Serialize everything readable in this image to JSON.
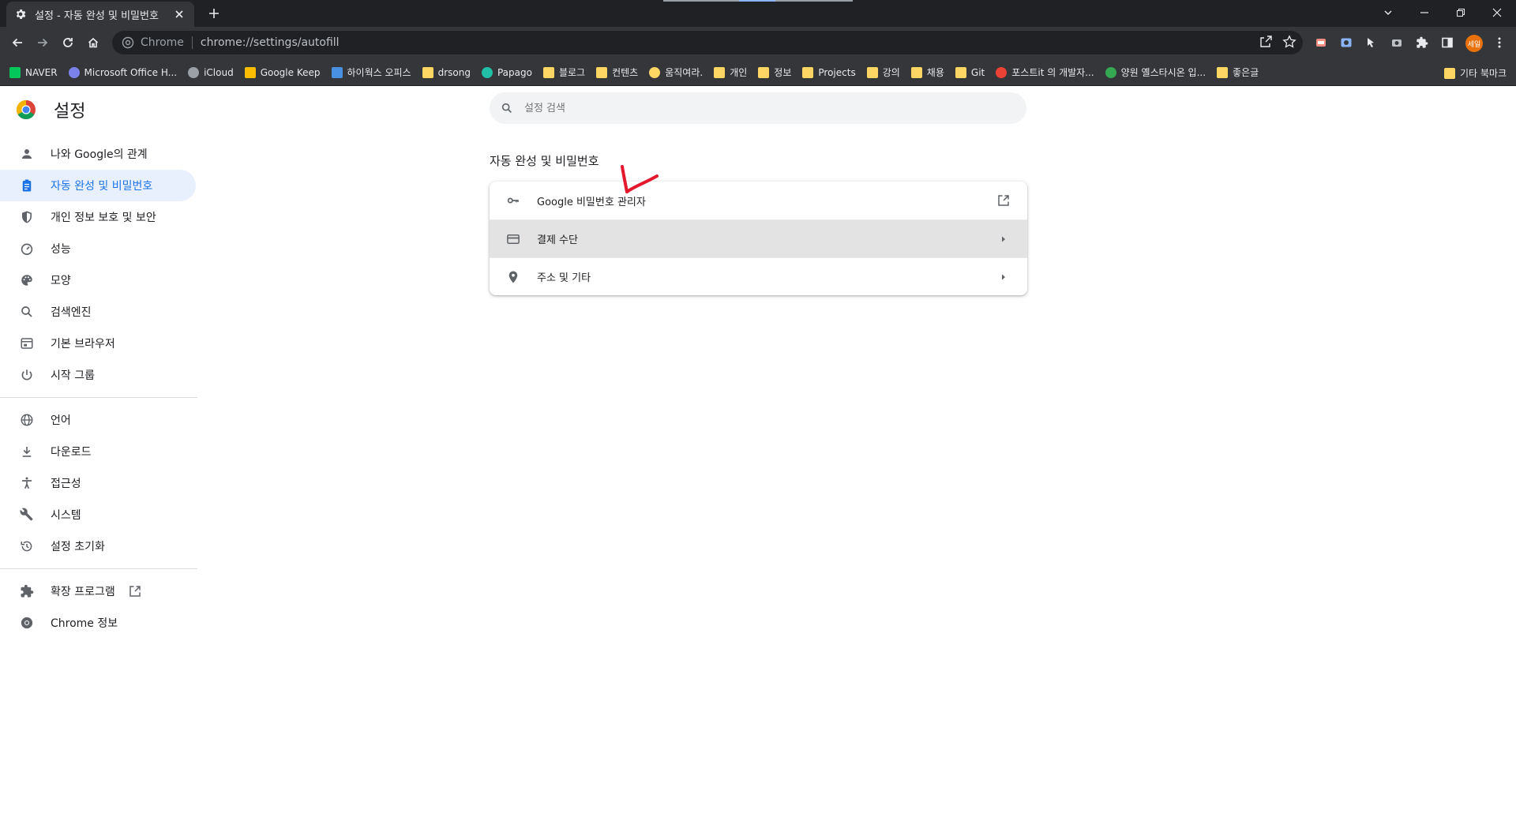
{
  "tab": {
    "title": "설정 - 자동 완성 및 비밀번호"
  },
  "omnibox": {
    "chip": "Chrome",
    "url": "chrome://settings/autofill"
  },
  "profile": {
    "label": "세일"
  },
  "bookmarks": [
    {
      "label": "NAVER",
      "color": "#03c75a",
      "icon": "naver-icon"
    },
    {
      "label": "Microsoft Office H...",
      "color": "#7b83eb",
      "icon": "office-icon"
    },
    {
      "label": "iCloud",
      "color": "#9aa0a6",
      "icon": "apple-icon"
    },
    {
      "label": "Google Keep",
      "color": "#fbbc04",
      "icon": "keep-icon"
    },
    {
      "label": "하이웍스 오피스",
      "color": "#4a90e2",
      "icon": "hiworks-icon"
    },
    {
      "label": "drsong",
      "color": "#fdd663",
      "icon": "folder-icon"
    },
    {
      "label": "Papago",
      "color": "#21c0a6",
      "icon": "papago-icon"
    },
    {
      "label": "블로그",
      "color": "#fdd663",
      "icon": "folder-icon"
    },
    {
      "label": "컨텐츠",
      "color": "#fdd663",
      "icon": "folder-icon"
    },
    {
      "label": "움직여라.",
      "color": "#fdd663",
      "icon": "lightbulb-icon"
    },
    {
      "label": "개인",
      "color": "#fdd663",
      "icon": "folder-icon"
    },
    {
      "label": "정보",
      "color": "#fdd663",
      "icon": "folder-icon"
    },
    {
      "label": "Projects",
      "color": "#fdd663",
      "icon": "folder-icon"
    },
    {
      "label": "강의",
      "color": "#fdd663",
      "icon": "folder-icon"
    },
    {
      "label": "채용",
      "color": "#fdd663",
      "icon": "folder-icon"
    },
    {
      "label": "Git",
      "color": "#fdd663",
      "icon": "folder-icon"
    },
    {
      "label": "포스트it 의 개발자...",
      "color": "#ea4335",
      "icon": "postit-icon"
    },
    {
      "label": "양원 옐스타시온 입...",
      "color": "#34a853",
      "icon": "leaf-icon"
    },
    {
      "label": "좋은글",
      "color": "#fdd663",
      "icon": "folder-icon"
    }
  ],
  "other_bookmarks": {
    "label": "기타 북마크"
  },
  "settings": {
    "title": "설정"
  },
  "sidebar": {
    "items": [
      {
        "label": "나와 Google의 관계",
        "icon": "person-icon"
      },
      {
        "label": "자동 완성 및 비밀번호",
        "icon": "clipboard-icon",
        "active": true
      },
      {
        "label": "개인 정보 보호 및 보안",
        "icon": "shield-icon"
      },
      {
        "label": "성능",
        "icon": "gauge-icon"
      },
      {
        "label": "모양",
        "icon": "palette-icon"
      },
      {
        "label": "검색엔진",
        "icon": "search-icon"
      },
      {
        "label": "기본 브라우저",
        "icon": "browser-icon"
      },
      {
        "label": "시작 그룹",
        "icon": "power-icon"
      }
    ],
    "advanced": [
      {
        "label": "언어",
        "icon": "globe-icon"
      },
      {
        "label": "다운로드",
        "icon": "download-icon"
      },
      {
        "label": "접근성",
        "icon": "accessibility-icon"
      },
      {
        "label": "시스템",
        "icon": "wrench-icon"
      },
      {
        "label": "설정 초기화",
        "icon": "history-icon"
      }
    ],
    "extensions_label": "확장 프로그램",
    "about_label": "Chrome 정보"
  },
  "search": {
    "placeholder": "설정 검색"
  },
  "main": {
    "section_title": "자동 완성 및 비밀번호",
    "rows": [
      {
        "label": "Google 비밀번호 관리자",
        "icon": "key-icon",
        "end": "open-in-new-icon"
      },
      {
        "label": "결제 수단",
        "icon": "credit-card-icon",
        "end": "arrow-right-icon"
      },
      {
        "label": "주소 및 기타",
        "icon": "location-pin-icon",
        "end": "arrow-right-icon"
      }
    ]
  },
  "colors": {
    "accent": "#1a73e8",
    "active_bg": "#e8f0fe",
    "annotation": "#e3182d"
  }
}
